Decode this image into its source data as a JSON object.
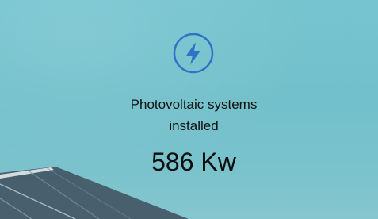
{
  "stat": {
    "icon": "lightning-bolt-icon",
    "label_line1": "Photovoltaic systems",
    "label_line2": "installed",
    "value": "586 Kw"
  },
  "colors": {
    "icon_accent": "#2f73c7",
    "text": "#111111",
    "sky": "#76c4cf"
  }
}
